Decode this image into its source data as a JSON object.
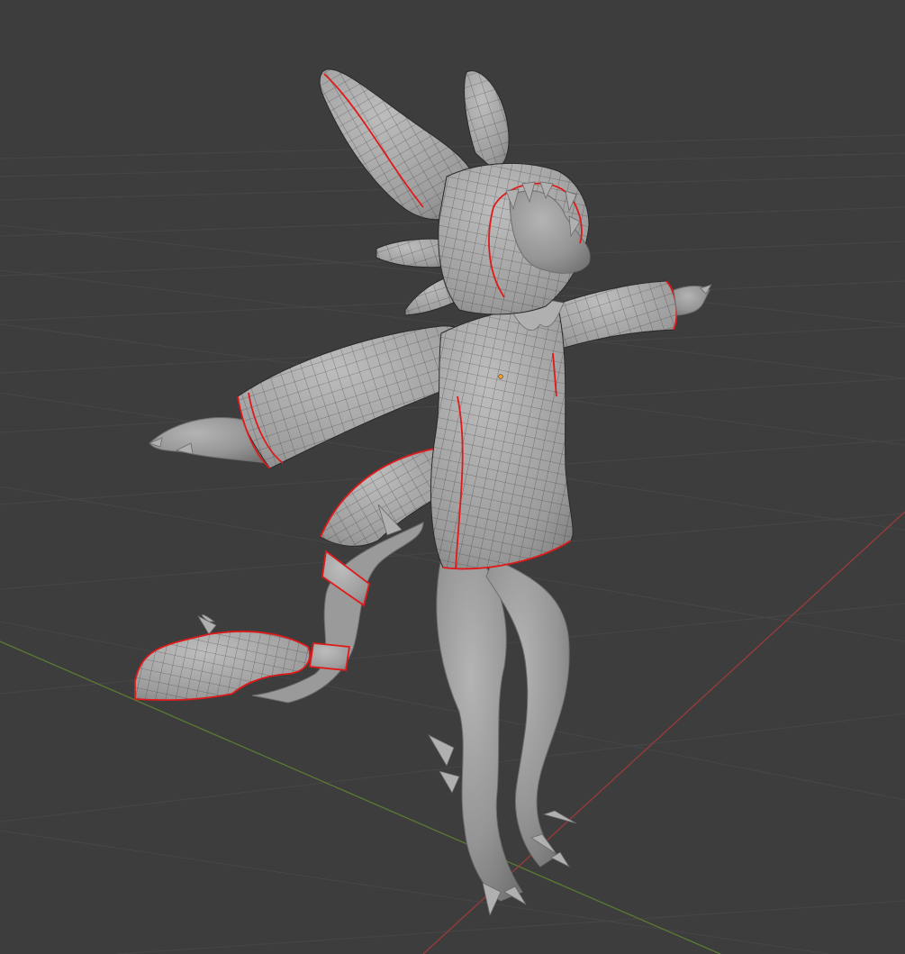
{
  "viewport": {
    "background_color": "#3d3d3d",
    "grid_color": "#474747",
    "x_axis_color": "#9b3b3b",
    "y_axis_color": "#5b7a34",
    "seam_color": "#e01a1a",
    "mesh_color": "#9a9a9a",
    "wireframe_color": "#202020",
    "origin_color": "#f0a030"
  }
}
